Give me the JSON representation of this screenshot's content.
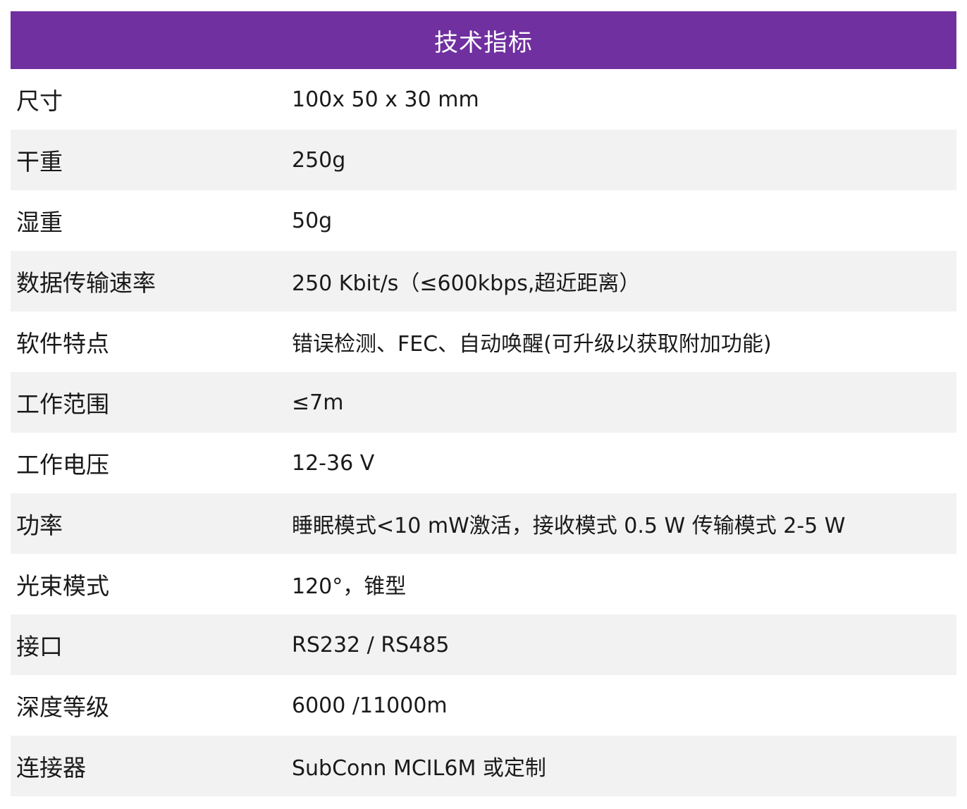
{
  "table": {
    "title": "技术指标",
    "rows": [
      {
        "label": "尺寸",
        "value": "100x 50 x 30 mm"
      },
      {
        "label": "干重",
        "value": "250g"
      },
      {
        "label": "湿重",
        "value": "50g"
      },
      {
        "label": "数据传输速率",
        "value": "250 Kbit/s（≤600kbps,超近距离）"
      },
      {
        "label": "软件特点",
        "value": "错误检测、FEC、自动唤醒(可升级以获取附加功能)"
      },
      {
        "label": "工作范围",
        "value": "≤7m"
      },
      {
        "label": "工作电压",
        "value": "12-36 V"
      },
      {
        "label": "功率",
        "value": "睡眠模式<10 mW激活，接收模式 0.5 W  传输模式 2-5 W"
      },
      {
        "label": "光束模式",
        "value": "120°，锥型"
      },
      {
        "label": "接口",
        "value": "RS232 / RS485"
      },
      {
        "label": "深度等级",
        "value": "6000 /11000m"
      },
      {
        "label": "连接器",
        "value": "SubConn MCIL6M 或定制"
      }
    ]
  },
  "colors": {
    "header_bg": "#7030a0",
    "header_text": "#ffffff",
    "row_alt_bg": "#f2f2f2"
  }
}
